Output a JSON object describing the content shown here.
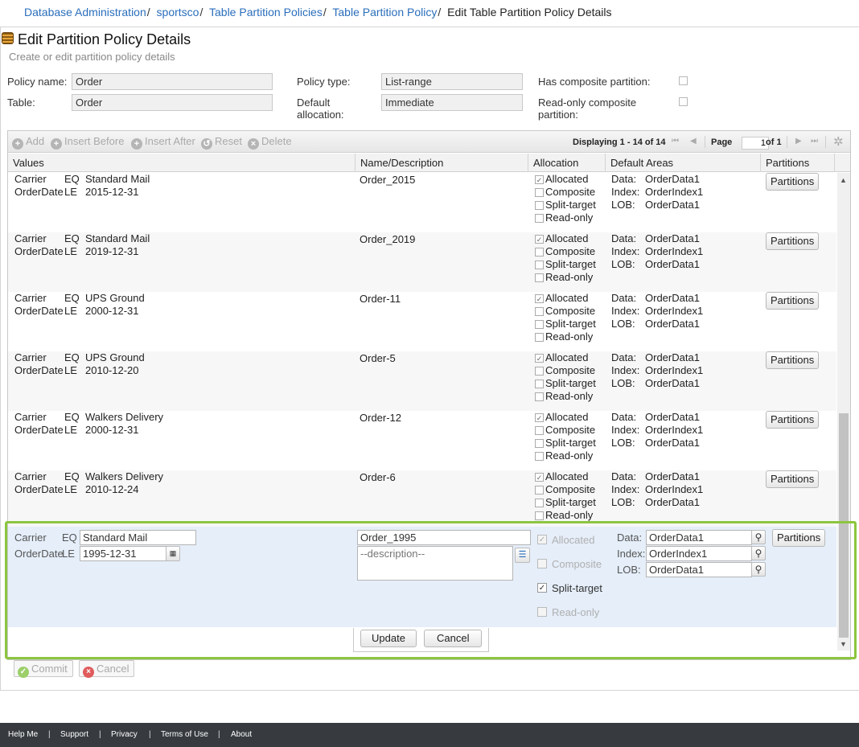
{
  "breadcrumb": {
    "items": [
      "Database Administration",
      "sportsco",
      "Table Partition Policies",
      "Table Partition Policy"
    ],
    "current": "Edit Table Partition Policy Details",
    "separator": "/"
  },
  "page": {
    "title": "Edit Partition Policy Details",
    "subtitle": "Create or edit partition policy details"
  },
  "form": {
    "policy_name_label": "Policy name:",
    "policy_name_value": "Order",
    "table_label": "Table:",
    "table_value": "Order",
    "policy_type_label": "Policy type:",
    "policy_type_value": "List-range",
    "default_allocation_label": "Default allocation:",
    "default_allocation_value": "Immediate",
    "has_composite_label": "Has composite partition:",
    "readonly_composite_label": "Read-only composite partition:"
  },
  "toolbar": {
    "add": "Add",
    "insert_before": "Insert Before",
    "insert_after": "Insert After",
    "reset": "Reset",
    "delete": "Delete"
  },
  "pager": {
    "displaying": "Displaying 1 - 14 of 14",
    "page_label": "Page",
    "page_value": "1",
    "of_label": "of 1"
  },
  "columns": [
    "Values",
    "Name/Description",
    "Allocation",
    "Default Areas",
    "Partitions"
  ],
  "allocation_labels": [
    "Allocated",
    "Composite",
    "Split-target",
    "Read-only"
  ],
  "area_labels": [
    "Data:",
    "Index:",
    "LOB:"
  ],
  "partitions_label": "Partitions",
  "rows": [
    {
      "col1": "Carrier",
      "op1": "EQ",
      "val1": "Standard Mail",
      "col2": "OrderDate",
      "op2": "LE",
      "val2": "2015-12-31",
      "name": "Order_2015",
      "data": "OrderData1",
      "index": "OrderIndex1",
      "lob": "OrderData1",
      "allocated": "✓"
    },
    {
      "col1": "Carrier",
      "op1": "EQ",
      "val1": "Standard Mail",
      "col2": "OrderDate",
      "op2": "LE",
      "val2": "2019-12-31",
      "name": "Order_2019",
      "data": "OrderData1",
      "index": "OrderIndex1",
      "lob": "OrderData1",
      "allocated": "✓"
    },
    {
      "col1": "Carrier",
      "op1": "EQ",
      "val1": "UPS Ground",
      "col2": "OrderDate",
      "op2": "LE",
      "val2": "2000-12-31",
      "name": "Order-11",
      "data": "OrderData1",
      "index": "OrderIndex1",
      "lob": "OrderData1",
      "allocated": "✓"
    },
    {
      "col1": "Carrier",
      "op1": "EQ",
      "val1": "UPS Ground",
      "col2": "OrderDate",
      "op2": "LE",
      "val2": "2010-12-20",
      "name": "Order-5",
      "data": "OrderData1",
      "index": "OrderIndex1",
      "lob": "OrderData1",
      "allocated": "✓"
    },
    {
      "col1": "Carrier",
      "op1": "EQ",
      "val1": "Walkers Delivery",
      "col2": "OrderDate",
      "op2": "LE",
      "val2": "2000-12-31",
      "name": "Order-12",
      "data": "OrderData1",
      "index": "OrderIndex1",
      "lob": "OrderData1",
      "allocated": "✓"
    },
    {
      "col1": "Carrier",
      "op1": "EQ",
      "val1": "Walkers Delivery",
      "col2": "OrderDate",
      "op2": "LE",
      "val2": "2010-12-24",
      "name": "Order-6",
      "data": "OrderData1",
      "index": "OrderIndex1",
      "lob": "OrderData1",
      "allocated": "✓"
    }
  ],
  "edit_row": {
    "col1": "Carrier",
    "op1": "EQ",
    "val1": "Standard Mail",
    "col2": "OrderDate",
    "op2": "LE",
    "val2": "1995-12-31",
    "name": "Order_1995",
    "description_placeholder": "--description--",
    "data": "OrderData1",
    "index": "OrderIndex1",
    "lob": "OrderData1",
    "allocated_check": "✓",
    "split_target_check": "✓"
  },
  "actions": {
    "update": "Update",
    "cancel": "Cancel",
    "commit": "Commit",
    "cancel_all": "Cancel"
  },
  "footer": {
    "links": [
      "Help Me",
      "Support",
      "Privacy",
      "Terms of Use",
      "About"
    ],
    "separator": "|"
  },
  "colors": {
    "link": "#2a6ebb",
    "edit_highlight": "#8cc63f",
    "edit_row_bg": "#e5eef9",
    "footer_bg": "#373b40"
  }
}
